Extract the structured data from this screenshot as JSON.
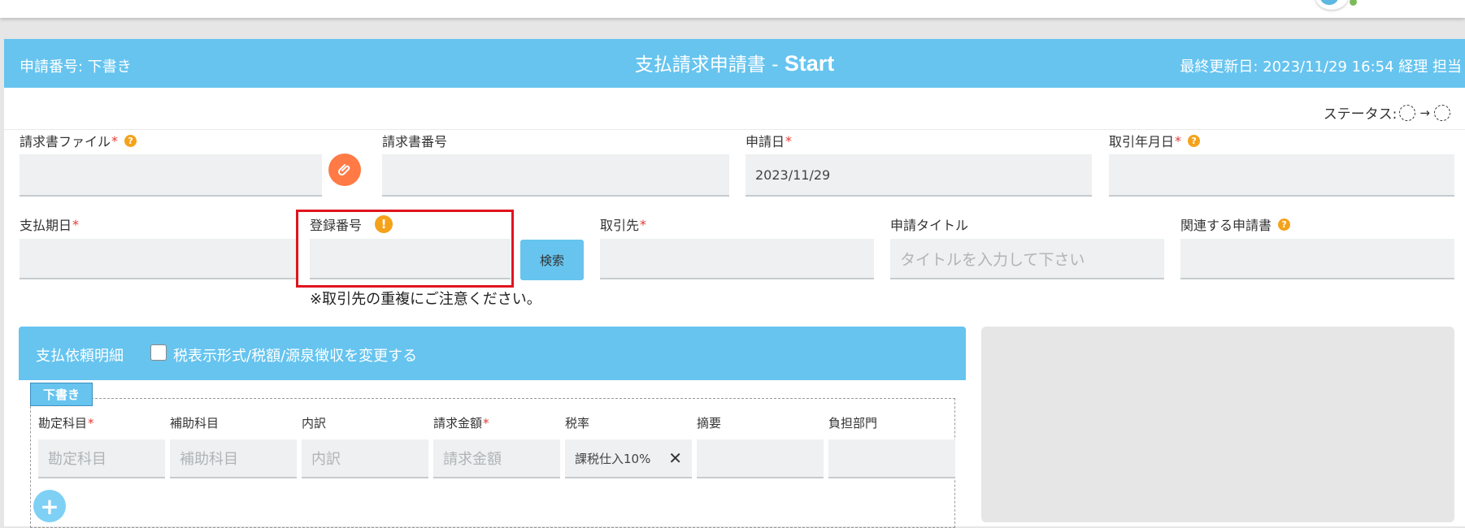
{
  "header": {
    "application_number_label": "申請番号: 下書き",
    "form_title": "支払請求申請書 - ",
    "form_state": "Start",
    "last_updated": "最終更新日: 2023/11/29 16:54  経理 担当"
  },
  "status": {
    "label": "ステータス:",
    "arrow": "→"
  },
  "row1": {
    "invoice_file_label": "請求書ファイル",
    "invoice_number_label": "請求書番号",
    "application_date_label": "申請日",
    "application_date_value": "2023/11/29",
    "transaction_month_label": "取引年月日"
  },
  "row2": {
    "payment_due_label": "支払期日",
    "registration_number_label": "登録番号",
    "search_button": "検索",
    "vendor_label": "取引先",
    "application_title_label": "申請タイトル",
    "application_title_placeholder": "タイトルを入力して下さい",
    "related_applications_label": "関連する申請書",
    "duplicate_note": "※取引先の重複にご注意ください。"
  },
  "required_mark": "*",
  "help_glyph": "?",
  "warning_glyph": "!",
  "detail": {
    "title": "支払依頼明細",
    "tax_toggle_label": "税表示形式/税額/源泉徴収を変更する",
    "tax_toggle_checked": false,
    "draft_tag": "下書き",
    "columns": {
      "account": "勘定科目",
      "sub_account": "補助科目",
      "breakdown": "内訳",
      "amount": "請求金額",
      "tax_rate": "税率",
      "summary": "摘要",
      "department": "負担部門"
    },
    "placeholders": {
      "account": "勘定科目",
      "sub_account": "補助科目",
      "breakdown": "内訳",
      "amount": "請求金額"
    },
    "tax_rate_value": "課税仕入10%",
    "clear_glyph": "✕",
    "add_glyph": "+"
  },
  "icons": {
    "attach": "paperclip-icon",
    "help": "question-circle-icon",
    "warning": "exclamation-circle-icon",
    "add": "plus-circle-icon",
    "clear": "close-icon"
  },
  "colors": {
    "accent": "#66c4ef",
    "attach_button": "#ff7a45",
    "help_badge": "#f5a21b",
    "required": "#e53935",
    "highlight_box": "#e0141e"
  }
}
